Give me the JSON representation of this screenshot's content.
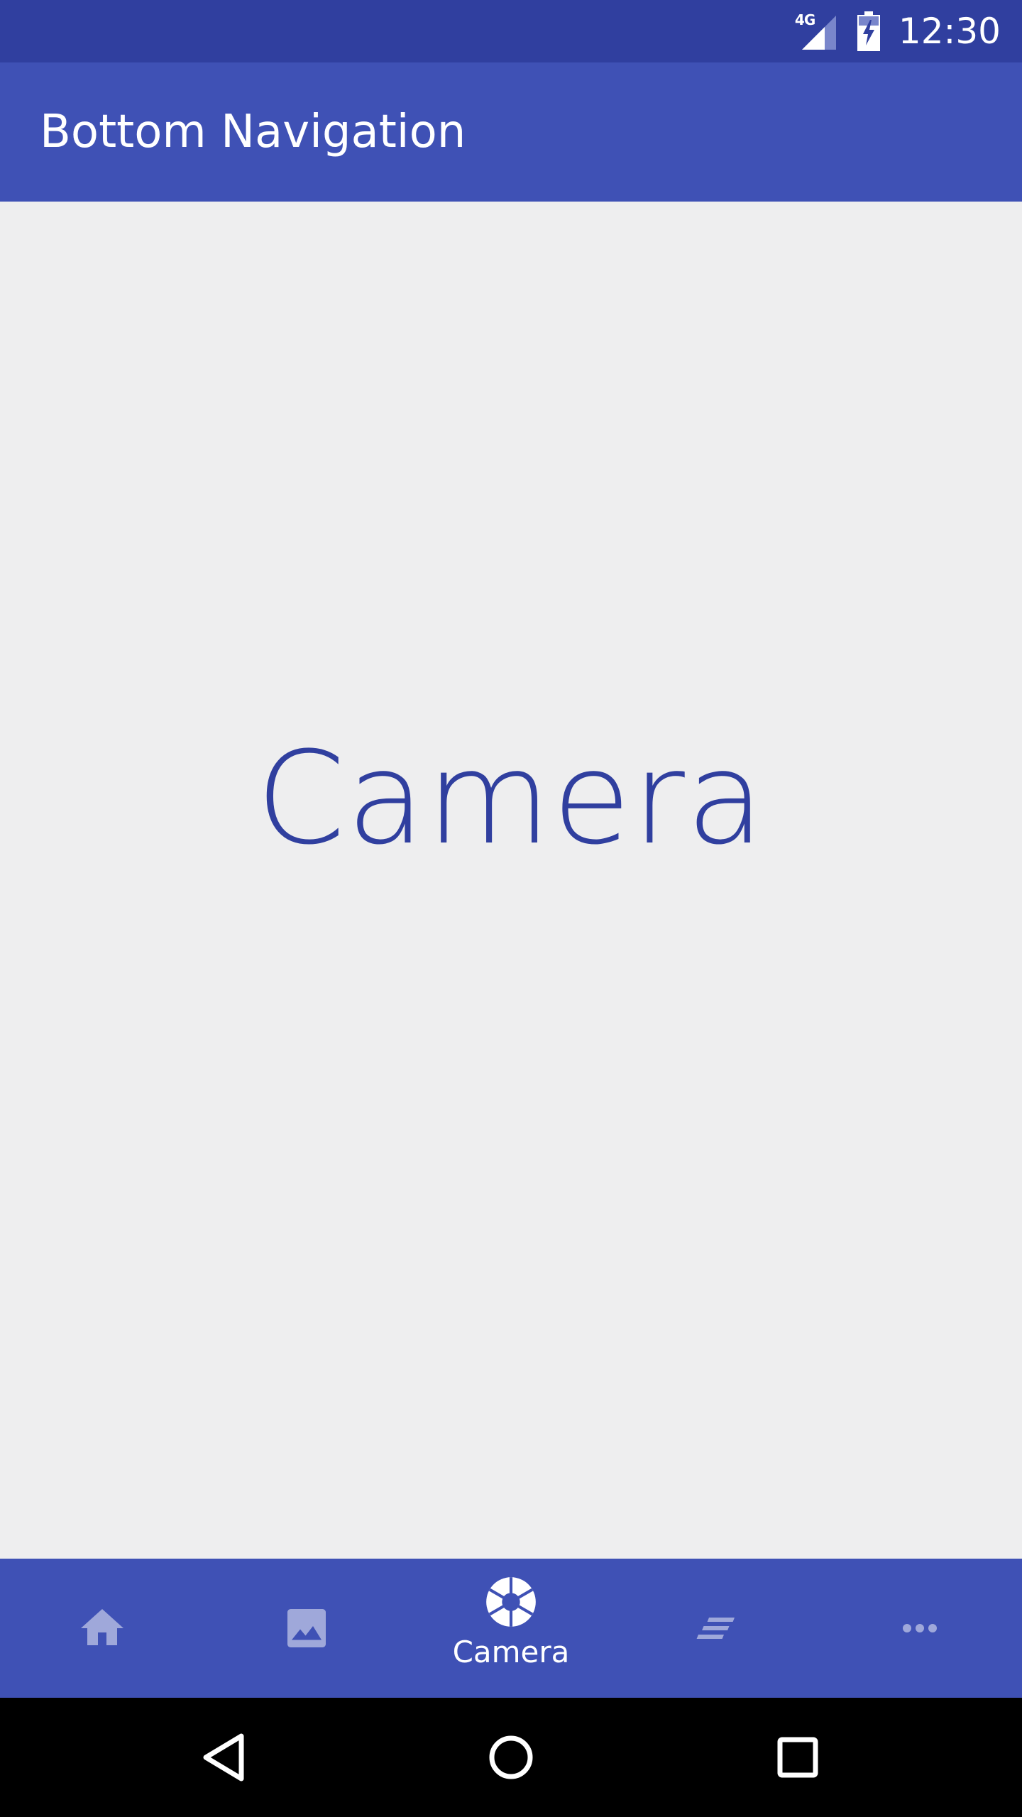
{
  "status_bar": {
    "network": "4G",
    "time": "12:30"
  },
  "app_bar": {
    "title": "Bottom Navigation"
  },
  "content": {
    "label": "Camera"
  },
  "bottom_nav": {
    "items": [
      {
        "label": "",
        "icon": "home-icon",
        "active": false
      },
      {
        "label": "",
        "icon": "image-icon",
        "active": false
      },
      {
        "label": "Camera",
        "icon": "camera-shutter-icon",
        "active": true
      },
      {
        "label": "",
        "icon": "notes-icon",
        "active": false
      },
      {
        "label": "",
        "icon": "more-horiz-icon",
        "active": false
      }
    ]
  },
  "colors": {
    "status_bar": "#303f9f",
    "primary": "#3f51b5",
    "content_background": "#eeeeef",
    "content_text": "#303f9f",
    "inactive_icon": "#9fa8da",
    "active_icon": "#ffffff"
  }
}
